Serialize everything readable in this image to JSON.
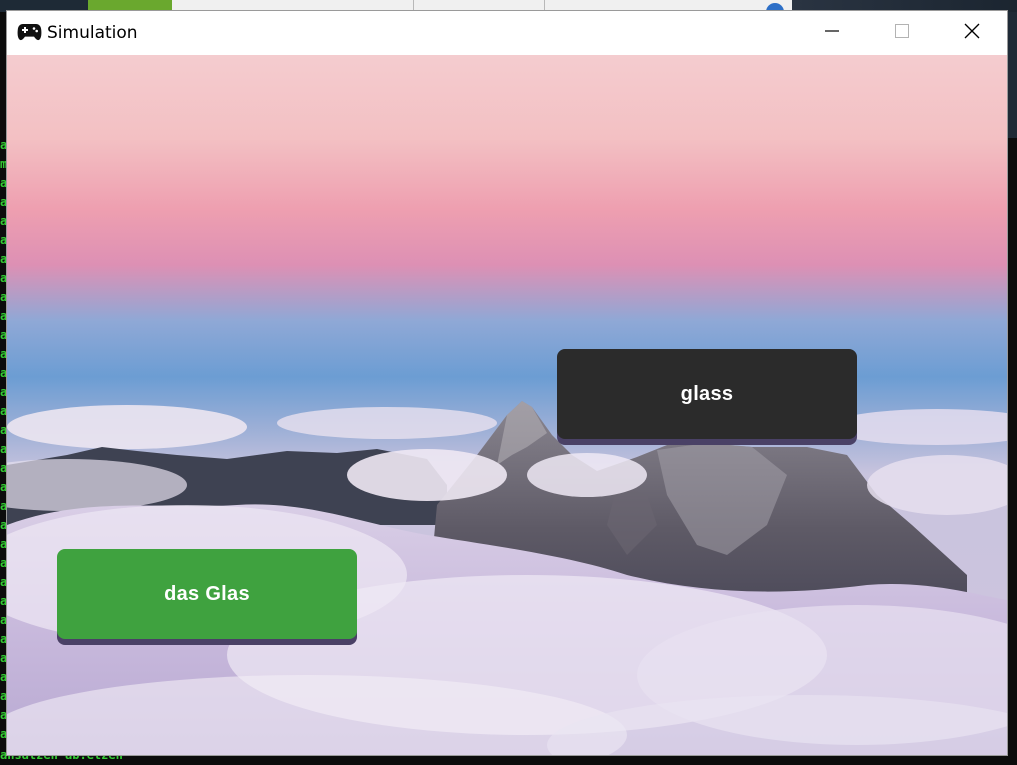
{
  "window": {
    "title": "Simulation",
    "icon": "gamepad-icon",
    "controls": [
      "minimize-icon",
      "maximize-icon",
      "close-icon"
    ]
  },
  "game": {
    "cards": [
      {
        "label": "glass",
        "color": "#2b2b2b"
      },
      {
        "label": "das Glas",
        "color": "#3fa23f"
      }
    ]
  },
  "background_terminal": {
    "side_chars": [
      "a",
      "m",
      "a",
      "a",
      "a",
      "a",
      "a",
      "a",
      "a",
      "a",
      "a",
      "a",
      "a",
      "a",
      "a",
      "a",
      "a",
      "a",
      "a",
      "a",
      "a",
      "a",
      "a",
      "a",
      "a",
      "a",
      "a",
      "a",
      "a",
      "a",
      "a",
      "a"
    ],
    "bottom_line": "ansatzen ab.etzen"
  }
}
